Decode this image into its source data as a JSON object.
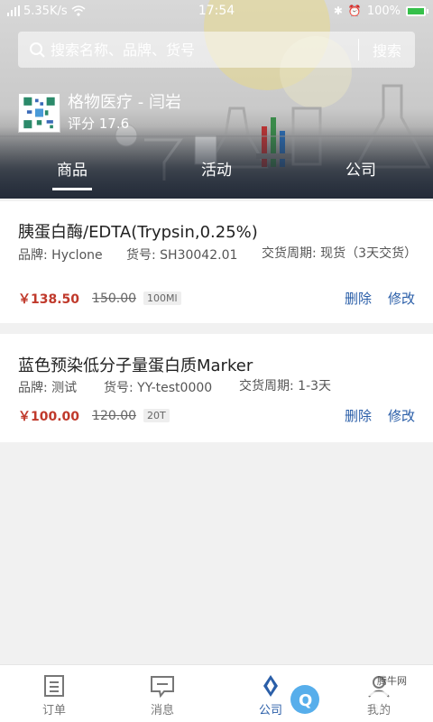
{
  "status_bar": {
    "signal": "5.35K/s",
    "time": "17:54",
    "battery": "100%",
    "battery_level": 1.0
  },
  "search": {
    "placeholder": "搜索名称、品牌、货号",
    "button_label": "搜索"
  },
  "store": {
    "name": "格物医疗 - 闫岩",
    "score": "评分 17.6"
  },
  "tabs": [
    {
      "label": "商品",
      "active": true
    },
    {
      "label": "活动",
      "active": false
    },
    {
      "label": "公司",
      "active": false
    }
  ],
  "products": [
    {
      "title": "胰蛋白酶/EDTA(Trypsin,0.25%)",
      "brand": "品牌: Hyclone",
      "code": "货号: SH30042.01",
      "lead_time": "交货周期: 现货（3天交货）",
      "price": "￥138.50",
      "old_price": "150.00",
      "spec": "100Ml",
      "delete_label": "删除",
      "edit_label": "修改"
    },
    {
      "title": "蓝色预染低分子量蛋白质Marker",
      "brand": "品牌: 测试",
      "code": "货号: YY-test0000",
      "lead_time": "交货周期: 1-3天",
      "price": "￥100.00",
      "old_price": "120.00",
      "spec": "20T",
      "delete_label": "删除",
      "edit_label": "修改"
    }
  ],
  "bottom_nav": [
    {
      "label": "订单",
      "icon": "orders-icon",
      "active": false
    },
    {
      "label": "消息",
      "icon": "message-icon",
      "active": false
    },
    {
      "label": "公司",
      "icon": "company-icon",
      "active": true
    },
    {
      "label": "我的",
      "icon": "profile-icon",
      "active": false
    }
  ],
  "watermark": {
    "text": "QQTN",
    "subtext": "腾牛网",
    "domain": ".com"
  },
  "colors": {
    "accent": "#2a5ea8",
    "price": "#c0392b",
    "battery_fill": "#35c04a"
  }
}
